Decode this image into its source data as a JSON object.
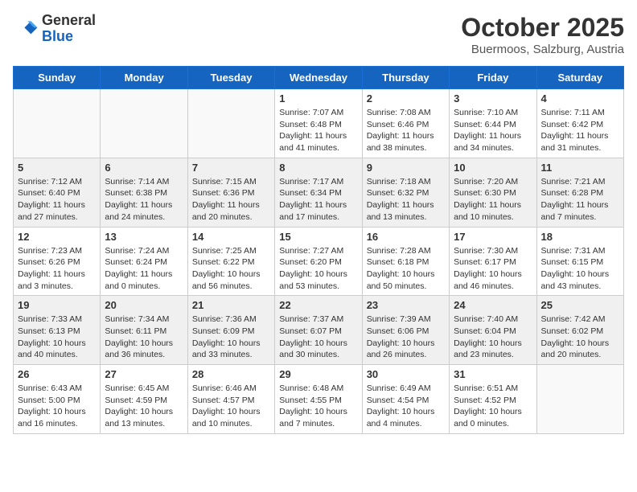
{
  "header": {
    "logo_general": "General",
    "logo_blue": "Blue",
    "month_title": "October 2025",
    "subtitle": "Buermoos, Salzburg, Austria"
  },
  "days_of_week": [
    "Sunday",
    "Monday",
    "Tuesday",
    "Wednesday",
    "Thursday",
    "Friday",
    "Saturday"
  ],
  "weeks": [
    {
      "shaded": false,
      "days": [
        {
          "num": "",
          "info": ""
        },
        {
          "num": "",
          "info": ""
        },
        {
          "num": "",
          "info": ""
        },
        {
          "num": "1",
          "info": "Sunrise: 7:07 AM\nSunset: 6:48 PM\nDaylight: 11 hours\nand 41 minutes."
        },
        {
          "num": "2",
          "info": "Sunrise: 7:08 AM\nSunset: 6:46 PM\nDaylight: 11 hours\nand 38 minutes."
        },
        {
          "num": "3",
          "info": "Sunrise: 7:10 AM\nSunset: 6:44 PM\nDaylight: 11 hours\nand 34 minutes."
        },
        {
          "num": "4",
          "info": "Sunrise: 7:11 AM\nSunset: 6:42 PM\nDaylight: 11 hours\nand 31 minutes."
        }
      ]
    },
    {
      "shaded": true,
      "days": [
        {
          "num": "5",
          "info": "Sunrise: 7:12 AM\nSunset: 6:40 PM\nDaylight: 11 hours\nand 27 minutes."
        },
        {
          "num": "6",
          "info": "Sunrise: 7:14 AM\nSunset: 6:38 PM\nDaylight: 11 hours\nand 24 minutes."
        },
        {
          "num": "7",
          "info": "Sunrise: 7:15 AM\nSunset: 6:36 PM\nDaylight: 11 hours\nand 20 minutes."
        },
        {
          "num": "8",
          "info": "Sunrise: 7:17 AM\nSunset: 6:34 PM\nDaylight: 11 hours\nand 17 minutes."
        },
        {
          "num": "9",
          "info": "Sunrise: 7:18 AM\nSunset: 6:32 PM\nDaylight: 11 hours\nand 13 minutes."
        },
        {
          "num": "10",
          "info": "Sunrise: 7:20 AM\nSunset: 6:30 PM\nDaylight: 11 hours\nand 10 minutes."
        },
        {
          "num": "11",
          "info": "Sunrise: 7:21 AM\nSunset: 6:28 PM\nDaylight: 11 hours\nand 7 minutes."
        }
      ]
    },
    {
      "shaded": false,
      "days": [
        {
          "num": "12",
          "info": "Sunrise: 7:23 AM\nSunset: 6:26 PM\nDaylight: 11 hours\nand 3 minutes."
        },
        {
          "num": "13",
          "info": "Sunrise: 7:24 AM\nSunset: 6:24 PM\nDaylight: 11 hours\nand 0 minutes."
        },
        {
          "num": "14",
          "info": "Sunrise: 7:25 AM\nSunset: 6:22 PM\nDaylight: 10 hours\nand 56 minutes."
        },
        {
          "num": "15",
          "info": "Sunrise: 7:27 AM\nSunset: 6:20 PM\nDaylight: 10 hours\nand 53 minutes."
        },
        {
          "num": "16",
          "info": "Sunrise: 7:28 AM\nSunset: 6:18 PM\nDaylight: 10 hours\nand 50 minutes."
        },
        {
          "num": "17",
          "info": "Sunrise: 7:30 AM\nSunset: 6:17 PM\nDaylight: 10 hours\nand 46 minutes."
        },
        {
          "num": "18",
          "info": "Sunrise: 7:31 AM\nSunset: 6:15 PM\nDaylight: 10 hours\nand 43 minutes."
        }
      ]
    },
    {
      "shaded": true,
      "days": [
        {
          "num": "19",
          "info": "Sunrise: 7:33 AM\nSunset: 6:13 PM\nDaylight: 10 hours\nand 40 minutes."
        },
        {
          "num": "20",
          "info": "Sunrise: 7:34 AM\nSunset: 6:11 PM\nDaylight: 10 hours\nand 36 minutes."
        },
        {
          "num": "21",
          "info": "Sunrise: 7:36 AM\nSunset: 6:09 PM\nDaylight: 10 hours\nand 33 minutes."
        },
        {
          "num": "22",
          "info": "Sunrise: 7:37 AM\nSunset: 6:07 PM\nDaylight: 10 hours\nand 30 minutes."
        },
        {
          "num": "23",
          "info": "Sunrise: 7:39 AM\nSunset: 6:06 PM\nDaylight: 10 hours\nand 26 minutes."
        },
        {
          "num": "24",
          "info": "Sunrise: 7:40 AM\nSunset: 6:04 PM\nDaylight: 10 hours\nand 23 minutes."
        },
        {
          "num": "25",
          "info": "Sunrise: 7:42 AM\nSunset: 6:02 PM\nDaylight: 10 hours\nand 20 minutes."
        }
      ]
    },
    {
      "shaded": false,
      "days": [
        {
          "num": "26",
          "info": "Sunrise: 6:43 AM\nSunset: 5:00 PM\nDaylight: 10 hours\nand 16 minutes."
        },
        {
          "num": "27",
          "info": "Sunrise: 6:45 AM\nSunset: 4:59 PM\nDaylight: 10 hours\nand 13 minutes."
        },
        {
          "num": "28",
          "info": "Sunrise: 6:46 AM\nSunset: 4:57 PM\nDaylight: 10 hours\nand 10 minutes."
        },
        {
          "num": "29",
          "info": "Sunrise: 6:48 AM\nSunset: 4:55 PM\nDaylight: 10 hours\nand 7 minutes."
        },
        {
          "num": "30",
          "info": "Sunrise: 6:49 AM\nSunset: 4:54 PM\nDaylight: 10 hours\nand 4 minutes."
        },
        {
          "num": "31",
          "info": "Sunrise: 6:51 AM\nSunset: 4:52 PM\nDaylight: 10 hours\nand 0 minutes."
        },
        {
          "num": "",
          "info": ""
        }
      ]
    }
  ]
}
